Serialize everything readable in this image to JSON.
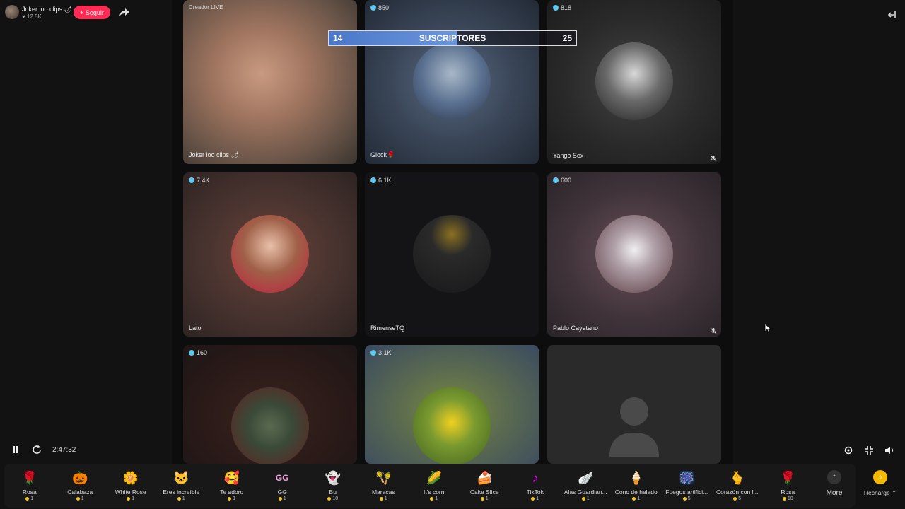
{
  "host": {
    "name": "Joker loo clips 🌶",
    "likes": "12.5K",
    "follow_label": "+ Seguir"
  },
  "subs_bar": {
    "left_value": "14",
    "title": "SUSCRIPTORES",
    "right_value": "25"
  },
  "tiles": [
    {
      "count": "",
      "name": "Joker loo clips 🌶",
      "badge": "Creador LIVE"
    },
    {
      "count": "850",
      "name": "Glock🌹"
    },
    {
      "count": "818",
      "name": "Yango Sex"
    },
    {
      "count": "7.4K",
      "name": "Lato"
    },
    {
      "count": "6.1K",
      "name": "RimenseTQ"
    },
    {
      "count": "600",
      "name": "Pablo Cayetano"
    },
    {
      "count": "160",
      "name": ""
    },
    {
      "count": "3.1K",
      "name": ""
    },
    {
      "count": "",
      "name": ""
    }
  ],
  "player": {
    "time": "2:47:32"
  },
  "gifts": [
    {
      "label": "Rosa",
      "price": "1",
      "icon": "rose-icon"
    },
    {
      "label": "Calabaza",
      "price": "1",
      "icon": "pumpkin-icon"
    },
    {
      "label": "White Rose",
      "price": "1",
      "icon": "white-rose-icon"
    },
    {
      "label": "Eres increíble",
      "price": "1",
      "icon": "cat-icon"
    },
    {
      "label": "Te adoro",
      "price": "1",
      "icon": "love-face-icon"
    },
    {
      "label": "GG",
      "price": "1",
      "icon": "gg-icon"
    },
    {
      "label": "Bu",
      "price": "10",
      "icon": "ghost-icon"
    },
    {
      "label": "Maracas",
      "price": "1",
      "icon": "maracas-icon"
    },
    {
      "label": "It's corn",
      "price": "1",
      "icon": "corn-icon"
    },
    {
      "label": "Cake Slice",
      "price": "1",
      "icon": "cake-icon"
    },
    {
      "label": "TikTok",
      "price": "1",
      "icon": "tiktok-icon"
    },
    {
      "label": "Alas Guardian...",
      "price": "1",
      "icon": "wings-icon"
    },
    {
      "label": "Cono de helado",
      "price": "1",
      "icon": "ice-cream-icon"
    },
    {
      "label": "Fuegos artifici...",
      "price": "5",
      "icon": "fireworks-icon"
    },
    {
      "label": "Corazón con l...",
      "price": "5",
      "icon": "heart-hand-icon"
    },
    {
      "label": "Rosa",
      "price": "10",
      "icon": "rose-icon"
    }
  ],
  "more_label": "More",
  "recharge_label": "Recharge ⌃"
}
